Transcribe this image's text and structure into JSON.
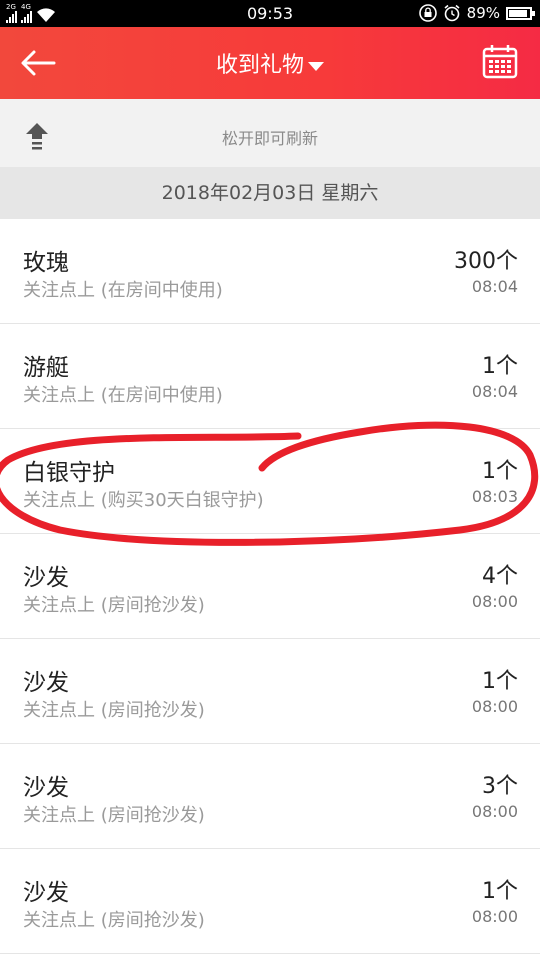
{
  "status_bar": {
    "net1": "2G",
    "net2": "4G",
    "time": "09:53",
    "battery": "89%",
    "battery_level": 0.89,
    "icons": [
      "signal-icon",
      "wifi-icon",
      "lock-icon",
      "alarm-clock-icon",
      "battery-icon"
    ]
  },
  "app_bar": {
    "title": "收到礼物",
    "back_icon": "back-arrow-icon",
    "dropdown_icon": "caret-down-icon",
    "calendar_icon": "calendar-icon"
  },
  "refresh": {
    "text": "松开即可刷新",
    "icon": "pull-up-arrow-icon"
  },
  "date_header": "2018年02月03日 星期六",
  "gifts": [
    {
      "name": "玫瑰",
      "desc": "关注点上 (在房间中使用)",
      "count": "300个",
      "time": "08:04"
    },
    {
      "name": "游艇",
      "desc": "关注点上 (在房间中使用)",
      "count": "1个",
      "time": "08:04"
    },
    {
      "name": "白银守护",
      "desc": "关注点上 (购买30天白银守护)",
      "count": "1个",
      "time": "08:03"
    },
    {
      "name": "沙发",
      "desc": "关注点上 (房间抢沙发)",
      "count": "4个",
      "time": "08:00"
    },
    {
      "name": "沙发",
      "desc": "关注点上 (房间抢沙发)",
      "count": "1个",
      "time": "08:00"
    },
    {
      "name": "沙发",
      "desc": "关注点上 (房间抢沙发)",
      "count": "3个",
      "time": "08:00"
    },
    {
      "name": "沙发",
      "desc": "关注点上 (房间抢沙发)",
      "count": "1个",
      "time": "08:00"
    }
  ],
  "colors": {
    "accent": "#f73a3a",
    "annotation": "#e8202a"
  }
}
